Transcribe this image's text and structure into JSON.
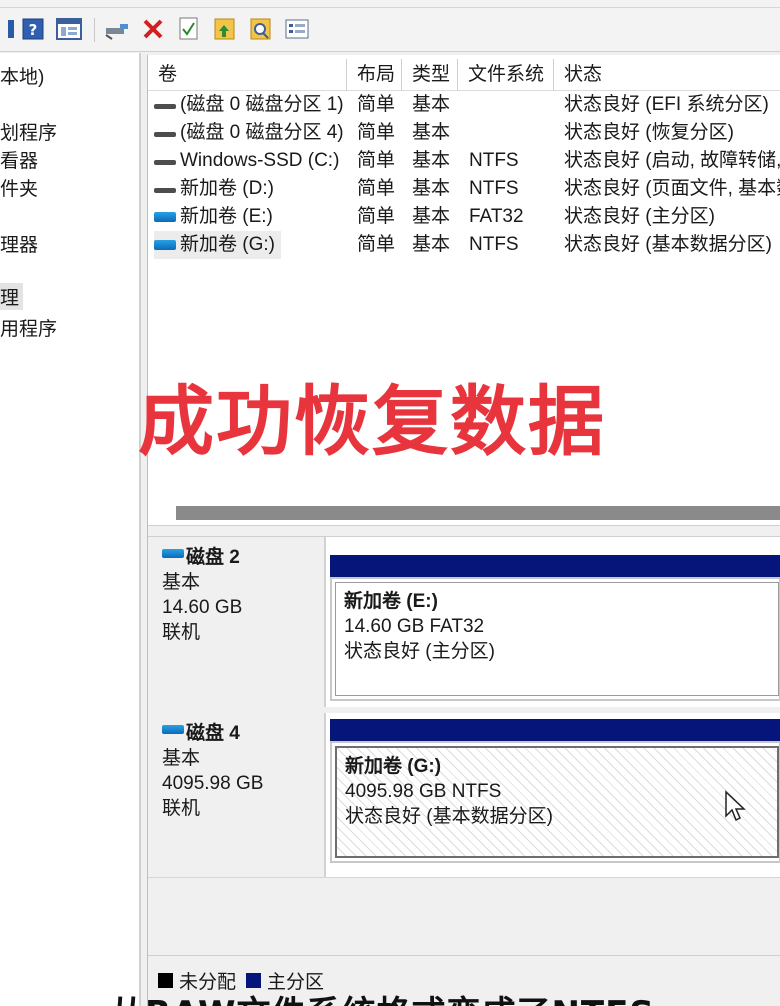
{
  "toolbar": {
    "icons": [
      "back-icon",
      "help-icon",
      "view-icon",
      "connect-icon",
      "delete-icon",
      "properties-icon",
      "export-icon",
      "search-icon",
      "list-icon"
    ]
  },
  "nav": {
    "items": [
      {
        "label": "本地)"
      },
      {
        "label": "划程序"
      },
      {
        "label": "看器"
      },
      {
        "label": "件夹"
      },
      {
        "label": "理器"
      },
      {
        "label": "理"
      },
      {
        "label": "用程序"
      }
    ]
  },
  "table": {
    "headers": [
      "卷",
      "布局",
      "类型",
      "文件系统",
      "状态"
    ],
    "rows": [
      {
        "icon": "gray",
        "name": "(磁盘 0 磁盘分区 1)",
        "layout": "简单",
        "type": "基本",
        "fs": "",
        "status": "状态良好 (EFI 系统分区)"
      },
      {
        "icon": "gray",
        "name": "(磁盘 0 磁盘分区 4)",
        "layout": "简单",
        "type": "基本",
        "fs": "",
        "status": "状态良好 (恢复分区)"
      },
      {
        "icon": "gray",
        "name": "Windows-SSD (C:)",
        "layout": "简单",
        "type": "基本",
        "fs": "NTFS",
        "status": "状态良好 (启动, 故障转储,"
      },
      {
        "icon": "gray",
        "name": "新加卷 (D:)",
        "layout": "简单",
        "type": "基本",
        "fs": "NTFS",
        "status": "状态良好 (页面文件, 基本数"
      },
      {
        "icon": "blue",
        "name": "新加卷 (E:)",
        "layout": "简单",
        "type": "基本",
        "fs": "FAT32",
        "status": "状态良好 (主分区)"
      },
      {
        "icon": "blue",
        "name": "新加卷 (G:)",
        "layout": "简单",
        "type": "基本",
        "fs": "NTFS",
        "status": "状态良好 (基本数据分区)"
      }
    ]
  },
  "overlay": {
    "text": "成功恢复数据"
  },
  "disks": [
    {
      "title": "磁盘 2",
      "kind": "基本",
      "size": "14.60 GB",
      "state": "联机",
      "partition": {
        "name": "新加卷 (E:)",
        "size_fs": "14.60 GB FAT32",
        "status": "状态良好 (主分区)"
      }
    },
    {
      "title": "磁盘 4",
      "kind": "基本",
      "size": "4095.98 GB",
      "state": "联机",
      "partition": {
        "name": "新加卷 (G:)",
        "size_fs": "4095.98 GB NTFS",
        "status": "状态良好 (基本数据分区)"
      }
    }
  ],
  "legend": {
    "unallocated": "未分配",
    "primary": "主分区",
    "unallocated_color": "#000000",
    "primary_color": "#06157a"
  },
  "caption": {
    "text": "从RAW文件系统格式变成了NTFS"
  },
  "colors": {
    "accent_red": "#e8343c",
    "partition_bar": "#06157a"
  }
}
